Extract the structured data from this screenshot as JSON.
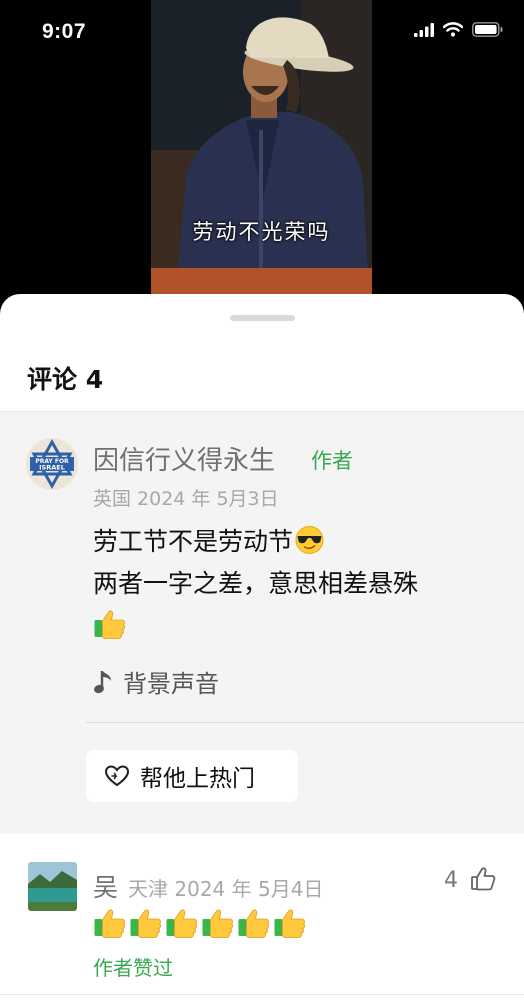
{
  "status_bar": {
    "time": "9:07",
    "icons": [
      "cellular-signal-icon",
      "wifi-icon",
      "battery-icon"
    ]
  },
  "video": {
    "subtitle": "劳动不光荣吗"
  },
  "comments_panel": {
    "title": "评论 4",
    "comments": [
      {
        "author": "因信行义得永生",
        "author_tag": "作者",
        "meta": "英国 2024 年 5月3日",
        "avatar_text": "PRAY FOR ISRAEL",
        "lines": [
          "劳工节不是劳动节",
          "两者一字之差，意思相差悬殊",
          ""
        ],
        "emoji": [
          "smiling-face-with-sunglasses",
          "thumbs-up"
        ],
        "music_label": "背景声音",
        "music_icon": "music-note-icon",
        "boost_label": "帮他上热门",
        "boost_icon": "heart-arrow-icon"
      },
      {
        "author": "吴",
        "meta": "天津 2024 年 5月4日",
        "likes": "4",
        "emoji": [
          "thumbs-up",
          "thumbs-up",
          "thumbs-up",
          "thumbs-up",
          "thumbs-up",
          "thumbs-up"
        ],
        "author_liked_label": "作者赞过",
        "like_icon": "thumbs-up-outline-icon"
      }
    ]
  },
  "colors": {
    "author_green": "#3aa853",
    "comment_highlight_bg": "#f4f4f4",
    "muted_text": "#a8a8a8"
  }
}
